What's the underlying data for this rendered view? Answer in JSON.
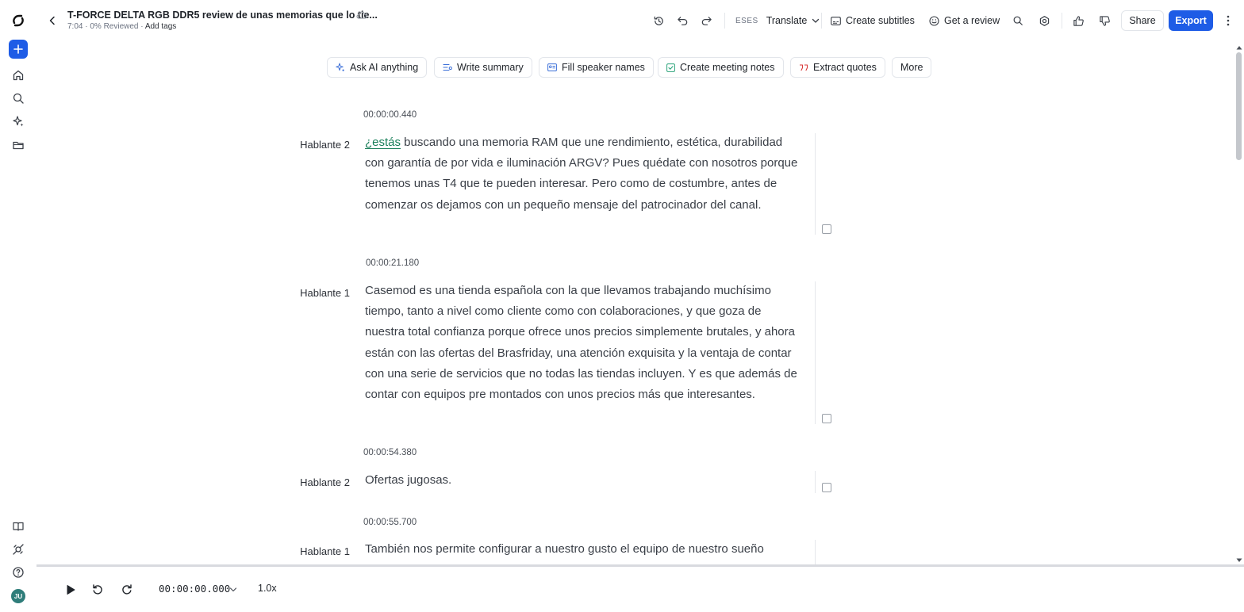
{
  "header": {
    "title": "T-FORCE DELTA RGB DDR5 review de unas memorias que lo tie...",
    "meta": "7:04 · 0% Reviewed · ",
    "add_tags": "Add tags",
    "translate_lang": "ESES",
    "translate_label": "Translate",
    "subtitles_label": "Create subtitles",
    "review_label": "Get a review",
    "share_label": "Share",
    "export_label": "Export"
  },
  "ai_actions": [
    {
      "label": "Ask AI anything"
    },
    {
      "label": "Write summary"
    },
    {
      "label": "Fill speaker names"
    },
    {
      "label": "Create meeting notes"
    },
    {
      "label": "Extract quotes"
    },
    {
      "label": "More"
    }
  ],
  "transcript": [
    {
      "timestamp": "00:00:00.440",
      "speaker": "Hablante 2",
      "highlight": "¿estás",
      "text": " buscando una memoria RAM que une rendimiento, estética, durabilidad con garantía de por vida e iluminación ARGV? Pues quédate con nosotros porque tenemos unas T4 que te pueden interesar. Pero como de costumbre, antes de comenzar os dejamos con un pequeño mensaje del patrocinador del canal."
    },
    {
      "timestamp": "00:00:21.180",
      "speaker": "Hablante 1",
      "text": "Casemod es una tienda española con la que llevamos trabajando muchísimo tiempo, tanto a nivel como cliente como con colaboraciones, y que goza de nuestra total confianza porque ofrece unos precios simplemente brutales, y ahora están con las ofertas del Brasfriday, una atención exquisita y la ventaja de contar con una serie de servicios que no todas las tiendas incluyen. Y es que además de contar con equipos pre montados con unos precios más que interesantes."
    },
    {
      "timestamp": "00:00:54.380",
      "speaker": "Hablante 2",
      "text": "Ofertas jugosas."
    },
    {
      "timestamp": "00:00:55.700",
      "speaker": "Hablante 1",
      "text": "También nos permite configurar a nuestro gusto el equipo de nuestro sueño"
    }
  ],
  "player": {
    "time": "00:00:00.000",
    "speed": "1.0x"
  },
  "user": {
    "initials": "JU"
  },
  "colors": {
    "accent": "#1e5ce6",
    "highlight_word": "#1a7f5a",
    "avatar": "#2f7d7a"
  }
}
